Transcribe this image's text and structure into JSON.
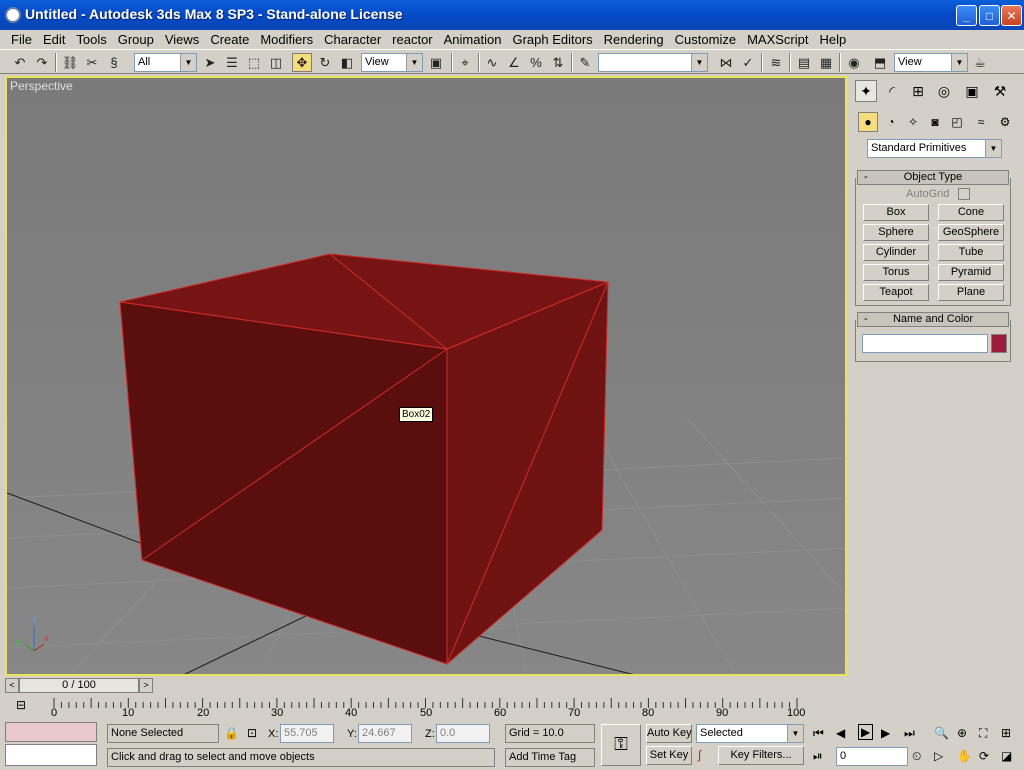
{
  "window": {
    "title": "Untitled  - Autodesk 3ds Max 8 SP3  - Stand-alone License",
    "minimize": "_",
    "maximize": "□",
    "close": "✕"
  },
  "menu": [
    "File",
    "Edit",
    "Tools",
    "Group",
    "Views",
    "Create",
    "Modifiers",
    "Character",
    "reactor",
    "Animation",
    "Graph Editors",
    "Rendering",
    "Customize",
    "MAXScript",
    "Help"
  ],
  "toolbar": {
    "selection_filter": "All",
    "ref_coord": "View",
    "named_selection": "",
    "render_view": "View"
  },
  "viewport": {
    "label": "Perspective",
    "tooltip": "Box02",
    "axis_x": "x",
    "axis_y": "y",
    "axis_z": "z",
    "object_color": "#6b1010"
  },
  "command_panel": {
    "category": "Standard Primitives",
    "object_type_title": "Object Type",
    "autogrid_label": "AutoGrid",
    "primitives": [
      "Box",
      "Cone",
      "Sphere",
      "GeoSphere",
      "Cylinder",
      "Tube",
      "Torus",
      "Pyramid",
      "Teapot",
      "Plane"
    ],
    "name_color_title": "Name and Color",
    "name_value": "",
    "swatch_color": "#9c1a3c",
    "rollout_minus": "-"
  },
  "timeline": {
    "frame_display": "0 / 100",
    "ticks": [
      "0",
      "10",
      "20",
      "30",
      "40",
      "50",
      "60",
      "70",
      "80",
      "90",
      "100"
    ]
  },
  "status": {
    "selection": "None Selected",
    "prompt": "Click and drag to select and move objects",
    "x_label": "X:",
    "x_value": "55.705",
    "y_label": "Y:",
    "y_value": "24.667",
    "z_label": "Z:",
    "z_value": "0.0",
    "grid": "Grid = 10.0",
    "add_time_tag": "Add Time Tag",
    "auto_key": "Auto Key",
    "set_key": "Set Key",
    "key_mode": "Selected",
    "key_filters": "Key Filters...",
    "current_frame": "0"
  }
}
